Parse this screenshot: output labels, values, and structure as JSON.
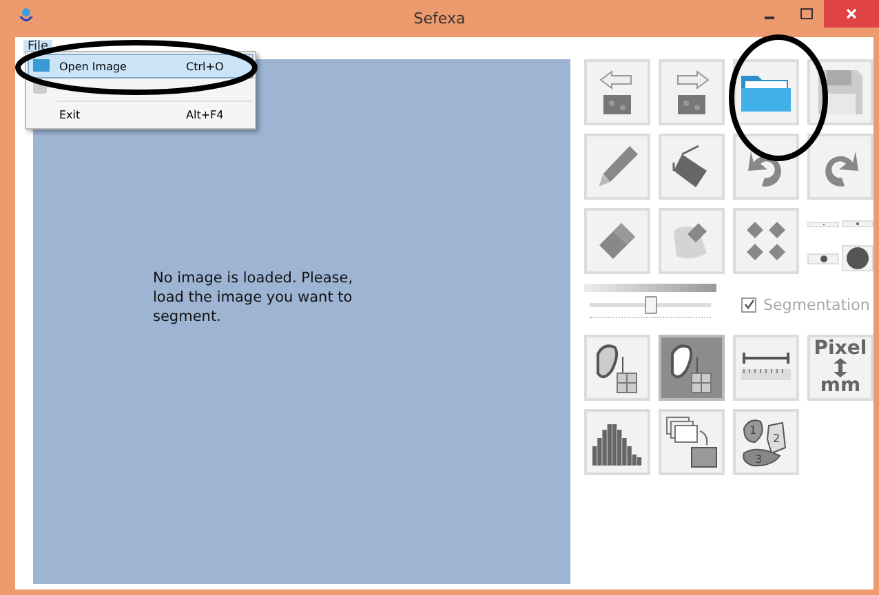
{
  "window": {
    "title": "Sefexa"
  },
  "menu_bar": [
    {
      "label": "File",
      "selected": true
    }
  ],
  "menu": [
    {
      "label": "Open Image",
      "shortcut": "Ctrl+O",
      "selected": true,
      "disabled": false
    },
    {
      "kind": "icon"
    },
    {
      "label": "Exit",
      "shortcut": "Alt+F4",
      "selected": false,
      "disabled": false
    }
  ],
  "canvas": {
    "message": "No image is loaded. Please, load the image you want to segment."
  },
  "toolbar_top": [
    {
      "kind": "prev",
      "selected": false
    },
    {
      "kind": "next",
      "selected": false
    },
    {
      "kind": "open",
      "selected": false
    },
    {
      "kind": "save",
      "selected": false
    },
    {
      "kind": "pencil",
      "selected": false
    },
    {
      "kind": "fill",
      "selected": false
    },
    {
      "kind": "undo",
      "selected": false
    },
    {
      "kind": "redo",
      "selected": false
    },
    {
      "kind": "eraser",
      "selected": false
    },
    {
      "kind": "smudge",
      "selected": false
    },
    {
      "kind": "scatter",
      "selected": false
    },
    {
      "kind": "sizes"
    }
  ],
  "brush": {
    "level": 0.5
  },
  "segmentation": {
    "label": "Segmentation",
    "checked": true,
    "disabled": true
  },
  "toolbar_bottom": [
    {
      "kind": "lasso",
      "selected": false
    },
    {
      "kind": "lasso",
      "selected": true
    },
    {
      "kind": "ruler",
      "selected": false
    },
    {
      "kind": "pixel",
      "top": "Pixel",
      "bottom": "mm",
      "selected": false
    },
    {
      "kind": "histogram",
      "selected": false
    },
    {
      "kind": "batch",
      "selected": false
    },
    {
      "kind": "regions",
      "numbers": [
        "1",
        "2",
        "3"
      ],
      "selected": false
    }
  ],
  "annotations": [
    {
      "kind": "ellipse"
    },
    {
      "kind": "ellipse"
    }
  ]
}
